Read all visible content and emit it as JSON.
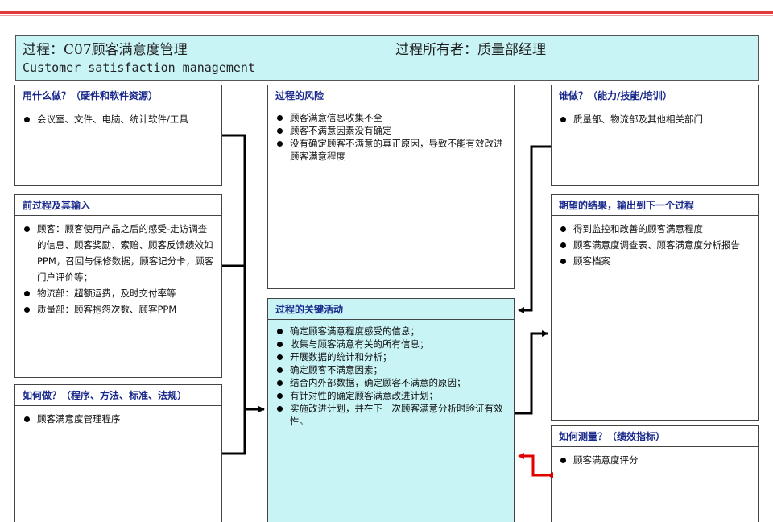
{
  "header": {
    "process_label": "过程：C07顾客满意度管理",
    "process_english": "Customer satisfaction management",
    "owner_label": "过程所有者：质量部经理"
  },
  "boxes": {
    "resources": {
      "title": "用什么做？（硬件和软件资源）",
      "items": [
        "会议室、文件、电脑、统计软件/工具"
      ]
    },
    "inputs": {
      "title": "前过程及其输入",
      "items": [
        "顾客：顾客使用产品之后的感受-走访调查的信息、顾客奖励、索赔、顾客反馈绩效如PPM，召回与保修数据，顾客记分卡，顾客门户评价等；",
        "物流部：超额运费，及时交付率等",
        "质量部：顾客抱怨次数、顾客PPM"
      ]
    },
    "methods": {
      "title": "如何做？（程序、方法、标准、法规）",
      "items": [
        "顾客满意度管理程序"
      ]
    },
    "risks": {
      "title": "过程的风险",
      "items": [
        "顾客满意信息收集不全",
        "顾客不满意因素没有确定",
        "没有确定顾客不满意的真正原因，导致不能有效改进顾客满意程度"
      ]
    },
    "activities": {
      "title": "过程的关键活动",
      "items": [
        "确定顾客满意程度感受的信息；",
        "收集与顾客满意有关的所有信息；",
        "开展数据的统计和分析；",
        "确定顾客不满意因素；",
        "结合内外部数据，确定顾客不满意的原因；",
        "有针对性的确定顾客满意改进计划；",
        "实施改进计划，并在下一次顾客满意分析时验证有效性。"
      ]
    },
    "who": {
      "title": "谁做？（能力/技能/培训）",
      "items": [
        "质量部、物流部及其他相关部门"
      ]
    },
    "outputs": {
      "title": "期望的结果，输出到下一个过程",
      "items": [
        "得到监控和改善的顾客满意程度",
        "顾客满意度调查表、顾客满意度分析报告",
        "顾客档案"
      ]
    },
    "measure": {
      "title": "如何测量？（绩效指标）",
      "items": [
        "顾客满意度评分"
      ]
    }
  },
  "colors": {
    "header_fill": "#c8f4f6",
    "activity_fill": "#c8f4f6",
    "title_text": "#1a2a8c",
    "connector": "#000000",
    "measure_arrow": "#e00000",
    "top_rule": "#e03a3a"
  }
}
